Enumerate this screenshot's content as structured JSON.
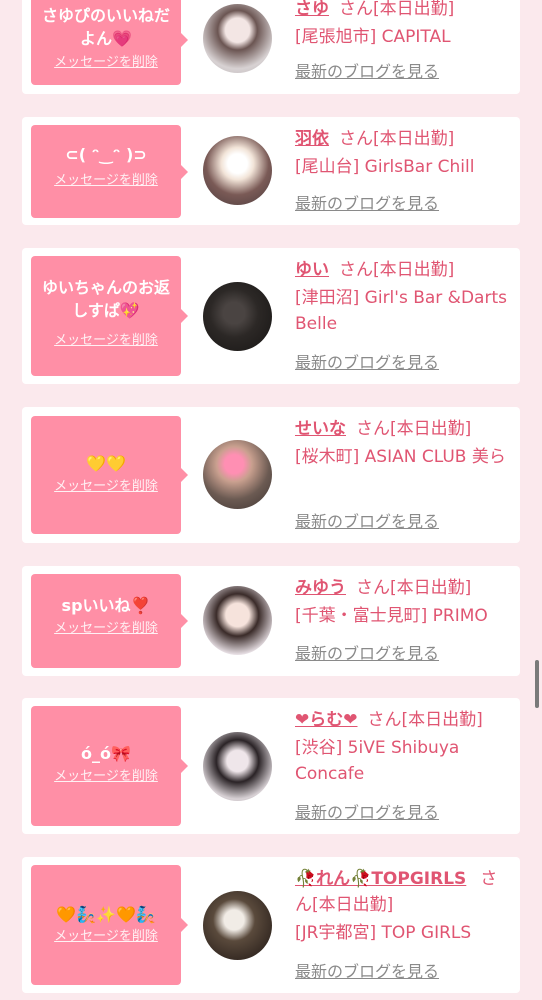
{
  "delete_label": "メッセージを削除",
  "blog_label": "最新のブログを見る",
  "san_label": "さん",
  "status_label": "[本日出勤]",
  "colors": {
    "accent": "#e05572",
    "bubble": "#ff8fa6",
    "background": "#fbe9ed"
  },
  "items": [
    {
      "message": "さゆぴのいいねだ\nよん💗",
      "name": "さゆ",
      "shop": "[尾張旭市] CAPITAL"
    },
    {
      "message": "⊂( ᵔ‿ᵔ )⊃",
      "name": "羽依",
      "shop": "[尾山台] GirlsBar Chill"
    },
    {
      "message": "ゆいちゃんのお返\nしすぱ💖",
      "name": "ゆい",
      "shop": "[津田沼] Girl's Bar &Darts Belle"
    },
    {
      "message": "💛💛",
      "name": "せいな",
      "shop": "[桜木町] ASIAN CLUB 美ら"
    },
    {
      "message": "spいいね❣️",
      "name": "みゆう",
      "shop": "[千葉・富士見町] PRIMO"
    },
    {
      "message": "ó_ó🎀",
      "name": "❤らむ❤",
      "shop": "[渋谷] 5iVE Shibuya Concafe"
    },
    {
      "message": "🧡🧞✨🧡🧞",
      "name": "🥀れん🥀TOPGIRLS",
      "shop": "[JR宇都宮] TOP GIRLS"
    }
  ]
}
